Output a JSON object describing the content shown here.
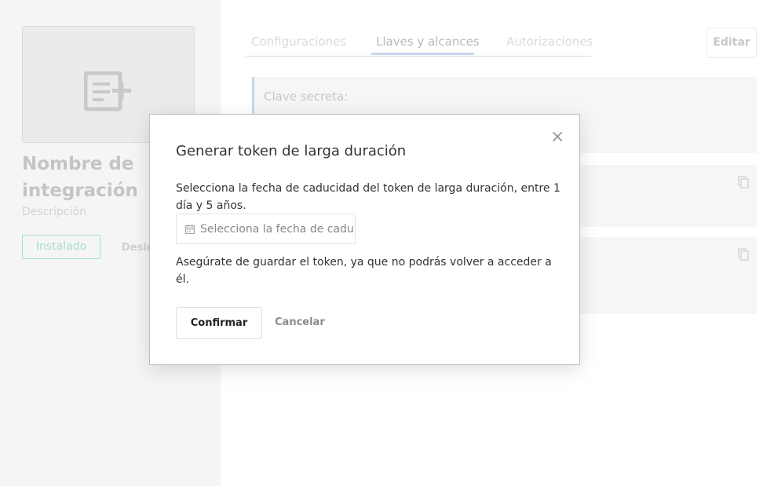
{
  "integration": {
    "name": "Nombre de integración",
    "description": "Descripción",
    "installed_label": "Instalado",
    "uninstall_label": "Desin",
    "logo_icon": "document-plus-icon"
  },
  "tabs": [
    {
      "label": "Configuraciones",
      "active": false
    },
    {
      "label": "Llaves y alcances",
      "active": true
    },
    {
      "label": "Autorizaciones",
      "active": false
    }
  ],
  "edit_label": "Editar",
  "cards": {
    "secret_label": "Clave secreta:",
    "copy_icon": "copy-icon"
  },
  "modal": {
    "title": "Generar token de larga duración",
    "description": "Selecciona la fecha de caducidad del token de larga duración, entre 1 día y 5 años.",
    "date_placeholder": "Selecciona la fecha de caducidad",
    "warning": "Asegúrate de guardar el token, ya que no podrás volver a acceder a él.",
    "confirm_label": "Confirmar",
    "cancel_label": "Cancelar",
    "close_glyph": "×"
  }
}
